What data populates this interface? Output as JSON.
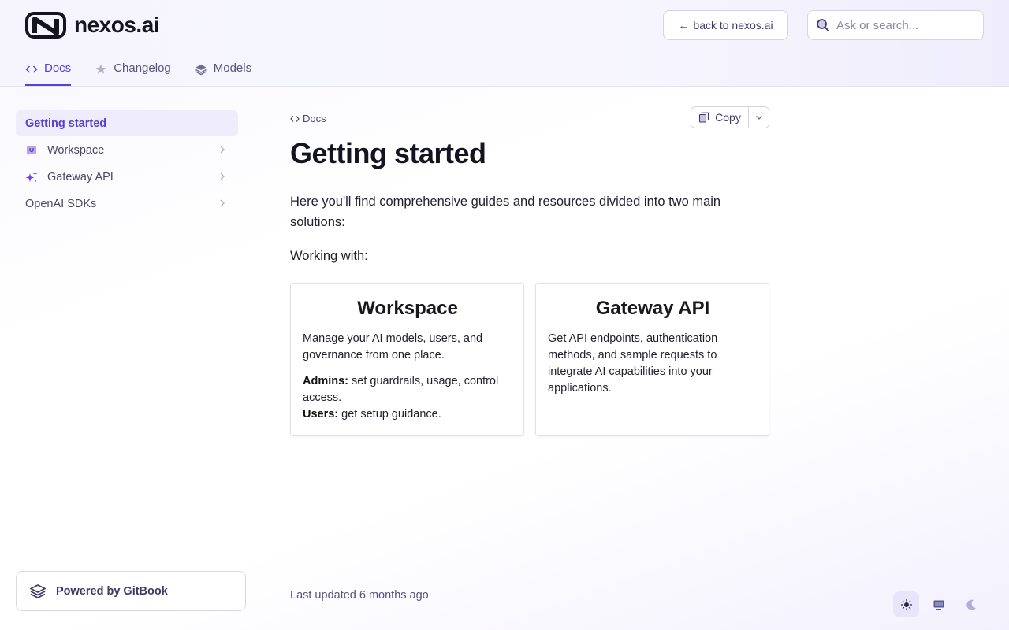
{
  "brand": {
    "name": "nexos.ai"
  },
  "header": {
    "back_label": "back to nexos.ai",
    "search_placeholder": "Ask or search..."
  },
  "tabs": [
    {
      "label": "Docs",
      "icon": "code-icon",
      "active": true
    },
    {
      "label": "Changelog",
      "icon": "star-icon",
      "active": false
    },
    {
      "label": "Models",
      "icon": "layers-icon",
      "active": false
    }
  ],
  "sidebar": {
    "items": [
      {
        "label": "Getting started",
        "active": true
      },
      {
        "label": "Workspace",
        "icon": "chat-smiley-icon"
      },
      {
        "label": "Gateway API",
        "icon": "sparkles-icon"
      },
      {
        "label": "OpenAI SDKs"
      }
    ],
    "powered_by": "Powered by GitBook"
  },
  "main": {
    "breadcrumb": "Docs",
    "copy_label": "Copy",
    "title": "Getting started",
    "intro": "Here you'll find comprehensive guides and resources divided into two main solutions:",
    "working_with": "Working with:",
    "cards": [
      {
        "title": "Workspace",
        "description": "Manage your AI models, users, and governance from one place.",
        "admins_label": "Admins:",
        "admins_text": " set guardrails, usage, control access.",
        "users_label": "Users:",
        "users_text": " get setup guidance."
      },
      {
        "title": "Gateway API",
        "description": "Get API endpoints, authentication methods, and sample requests to integrate AI capabilities into your applications."
      }
    ],
    "last_updated": "Last updated 6 months ago"
  },
  "theme": {
    "selected": "light"
  },
  "colors": {
    "accent": "#5b3fd1",
    "text_muted": "#56537a"
  }
}
